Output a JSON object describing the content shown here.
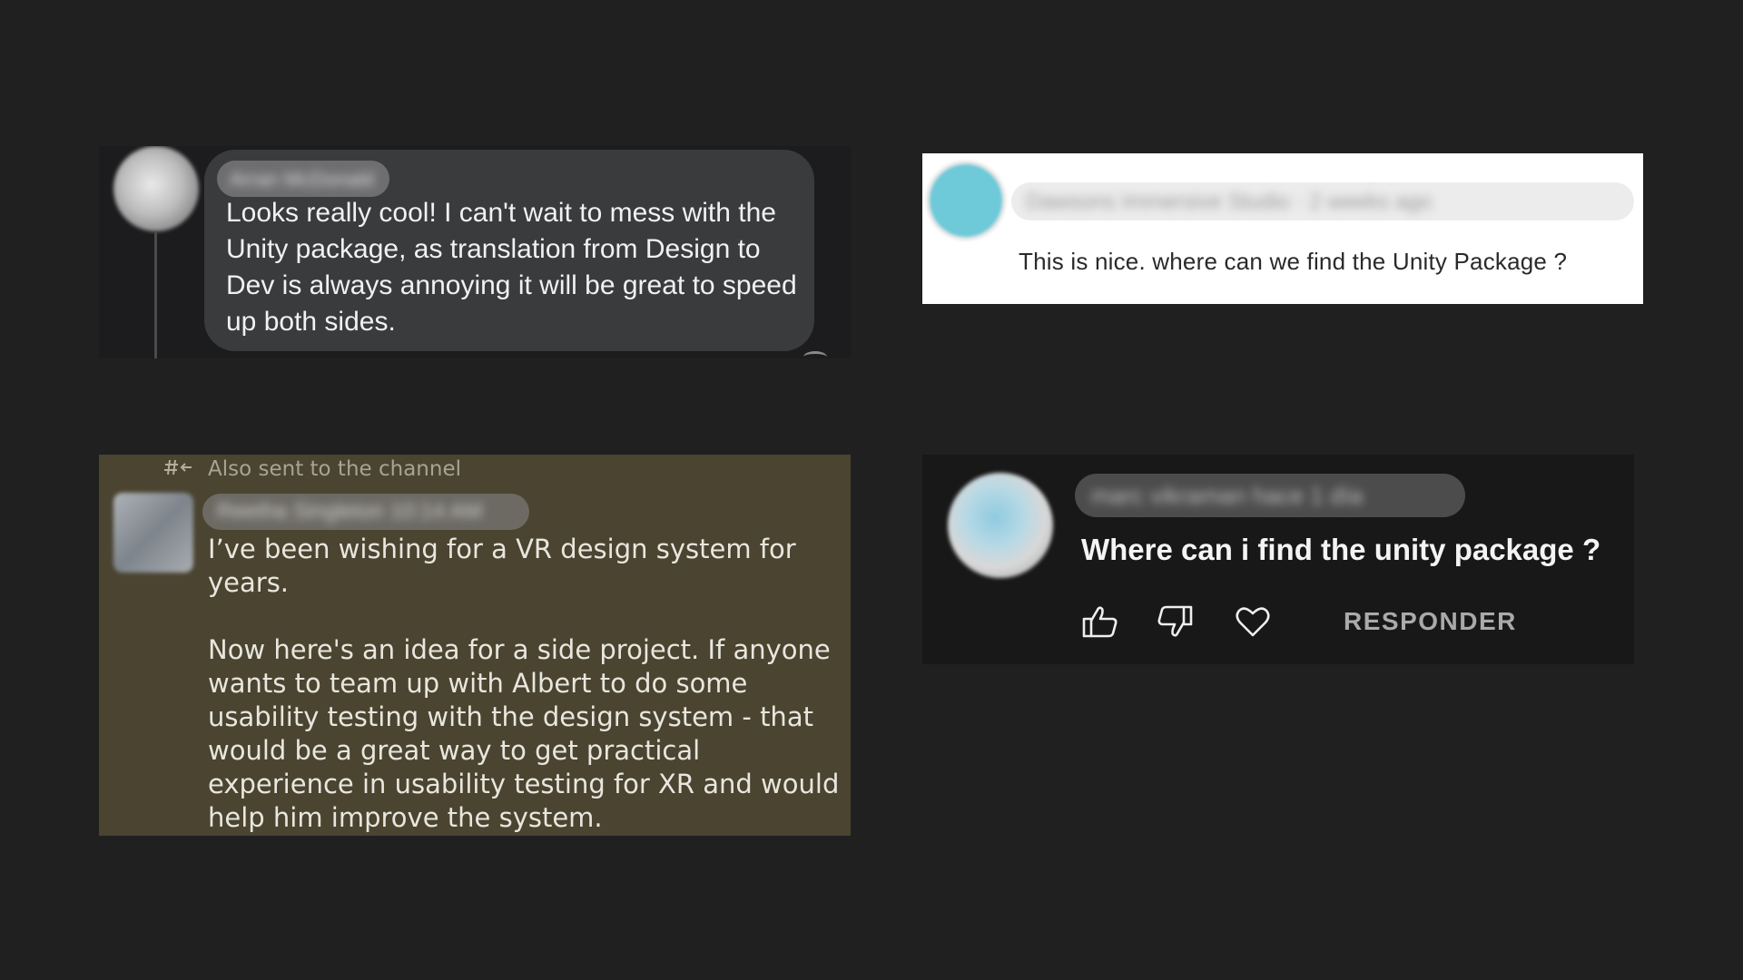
{
  "facebook_comment": {
    "author_name": "Arran McDonald",
    "text": "Looks really cool! I can't wait to mess with the Unity package, as translation from Design to Dev is always annoying it will be great to speed up both sides."
  },
  "white_comment": {
    "author_name": "Dawsons Immersive Studio · 2 weeks ago",
    "text": "This is nice. where can we find the Unity Package ?"
  },
  "slack_message": {
    "channel_note": "Also sent to the channel",
    "author_name": "Reetha Singleton 10:14 AM",
    "paragraph_1": "I’ve been wishing for a VR design system for years.",
    "paragraph_2": "Now here's an idea for a side project. If anyone wants to team up with Albert to do some usability testing with the design system - that would be a great way to get practical experience in usability testing for XR and would help him improve the system."
  },
  "youtube_comment": {
    "author_name": "marc vikraman hace 1 día",
    "text": "Where can i find the unity package ?",
    "icons": [
      "thumbs-up-icon",
      "thumbs-down-icon",
      "heart-icon"
    ],
    "reply_label": "RESPONDER"
  }
}
